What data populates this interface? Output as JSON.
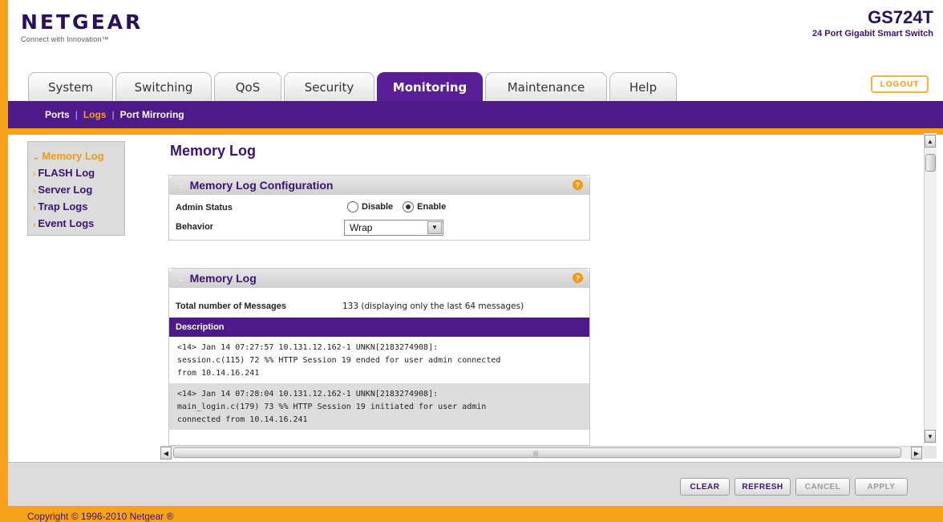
{
  "header": {
    "logo": "NETGEAR",
    "logo_tag": "Connect with Innovation™",
    "model_name": "GS724T",
    "model_desc": "24 Port Gigabit Smart Switch",
    "logout_label": "LOGOUT"
  },
  "tabs": [
    {
      "label": "System"
    },
    {
      "label": "Switching"
    },
    {
      "label": "QoS"
    },
    {
      "label": "Security"
    },
    {
      "label": "Monitoring",
      "active": true
    },
    {
      "label": "Maintenance"
    },
    {
      "label": "Help"
    }
  ],
  "subnav": {
    "items": [
      {
        "label": "Ports"
      },
      {
        "label": "Logs",
        "active": true
      },
      {
        "label": "Port Mirroring"
      }
    ]
  },
  "sidebar": {
    "items": [
      {
        "label": "Memory Log",
        "active": true
      },
      {
        "label": "FLASH Log"
      },
      {
        "label": "Server Log"
      },
      {
        "label": "Trap Logs"
      },
      {
        "label": "Event Logs"
      }
    ]
  },
  "page_title": "Memory Log",
  "config_panel": {
    "title": "Memory Log Configuration",
    "admin_status_label": "Admin Status",
    "disable_label": "Disable",
    "enable_label": "Enable",
    "admin_status_value": "Enable",
    "behavior_label": "Behavior",
    "behavior_value": "Wrap"
  },
  "log_panel": {
    "title": "Memory Log",
    "total_label": "Total number of Messages",
    "total_value": "133 (displaying only the last 64 messages)",
    "description_header": "Description",
    "entries": [
      {
        "line1": "<14> Jan 14 07:27:57 10.131.12.162-1 UNKN[2183274908]:",
        "line2": "session.c(115) 72 %% HTTP Session 19 ended for user admin connected",
        "line3": "from 10.14.16.241"
      },
      {
        "line1": "<14> Jan 14 07:28:04 10.131.12.162-1 UNKN[2183274908]:",
        "line2": "main_login.c(179) 73 %% HTTP Session 19 initiated for user admin",
        "line3": "connected from 10.14.16.241"
      }
    ]
  },
  "buttons": {
    "clear": "CLEAR",
    "refresh": "REFRESH",
    "cancel": "CANCEL",
    "apply": "APPLY"
  },
  "footer": {
    "copyright": "Copyright © 1996-2010 Netgear ®"
  },
  "colors": {
    "brand_purple": "#4d1a8a",
    "accent_orange": "#f7a21b"
  },
  "icons": {
    "help": "help-icon",
    "sidebar_bullet": "chevron-right-icon",
    "sidebar_active_bullet": "chevron-down-icon"
  }
}
